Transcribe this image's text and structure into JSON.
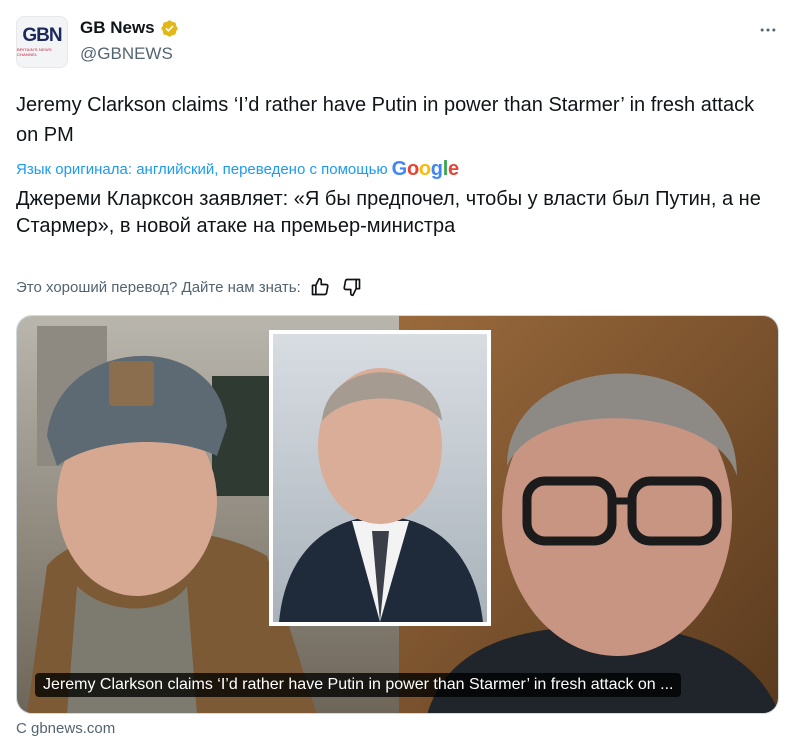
{
  "author": {
    "display_name": "GB News",
    "handle": "@GBNEWS",
    "avatar_logo": "GBN",
    "avatar_tagline": "BRITAIN'S NEWS CHANNEL",
    "verified_color": "#e2b719"
  },
  "post": {
    "original_text": "Jeremy Clarkson claims ‘I’d rather have Putin in power than Starmer’ in fresh attack on PM",
    "translation_label": "Язык оригинала: английский, переведено с помощью",
    "translator_brand": "Google",
    "translated_text": "Джереми Кларксон заявляет: «Я бы предпочел, чтобы у власти был Путин, а не Стармер», в новой атаке на премьер-министра",
    "feedback_prompt": "Это хороший перевод? Дайте нам знать:"
  },
  "link_card": {
    "caption": "Jeremy Clarkson claims ‘I’d rather have Putin in power than Starmer’ in fresh attack on ...",
    "source": "С gbnews.com"
  },
  "colors": {
    "link_blue": "#1d9bf0",
    "secondary_text": "#536471"
  }
}
